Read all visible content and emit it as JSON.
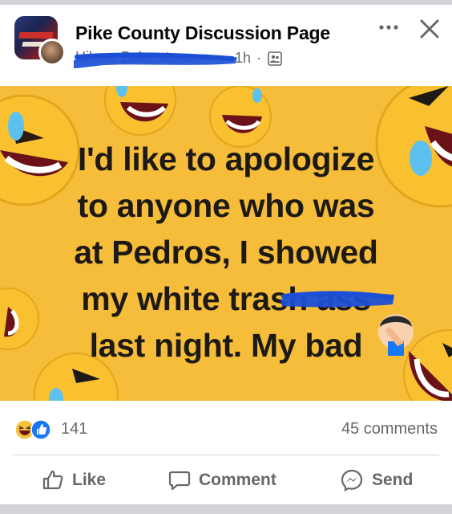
{
  "post": {
    "page_name": "Pike County Discussion Page",
    "author_name": "Hilmer Bakerstone",
    "time": "1h",
    "separator": "·",
    "audience_icon": "group-members-icon"
  },
  "image": {
    "text_lines": [
      "I'd like to apologize",
      "to anyone who was",
      "at Pedros, I showed",
      "my white trash ass",
      "last night. My bad"
    ],
    "background": "#f6bd3a",
    "emoji": "face-palm"
  },
  "reactions": {
    "types": [
      "haha-icon",
      "like-icon"
    ],
    "count": "141",
    "comments": "45 comments"
  },
  "actions": {
    "like": "Like",
    "comment": "Comment",
    "send": "Send"
  },
  "colors": {
    "text_primary": "#050505",
    "text_secondary": "#65676b",
    "like_blue": "#1877f2",
    "redaction": "#1c4fd6"
  }
}
